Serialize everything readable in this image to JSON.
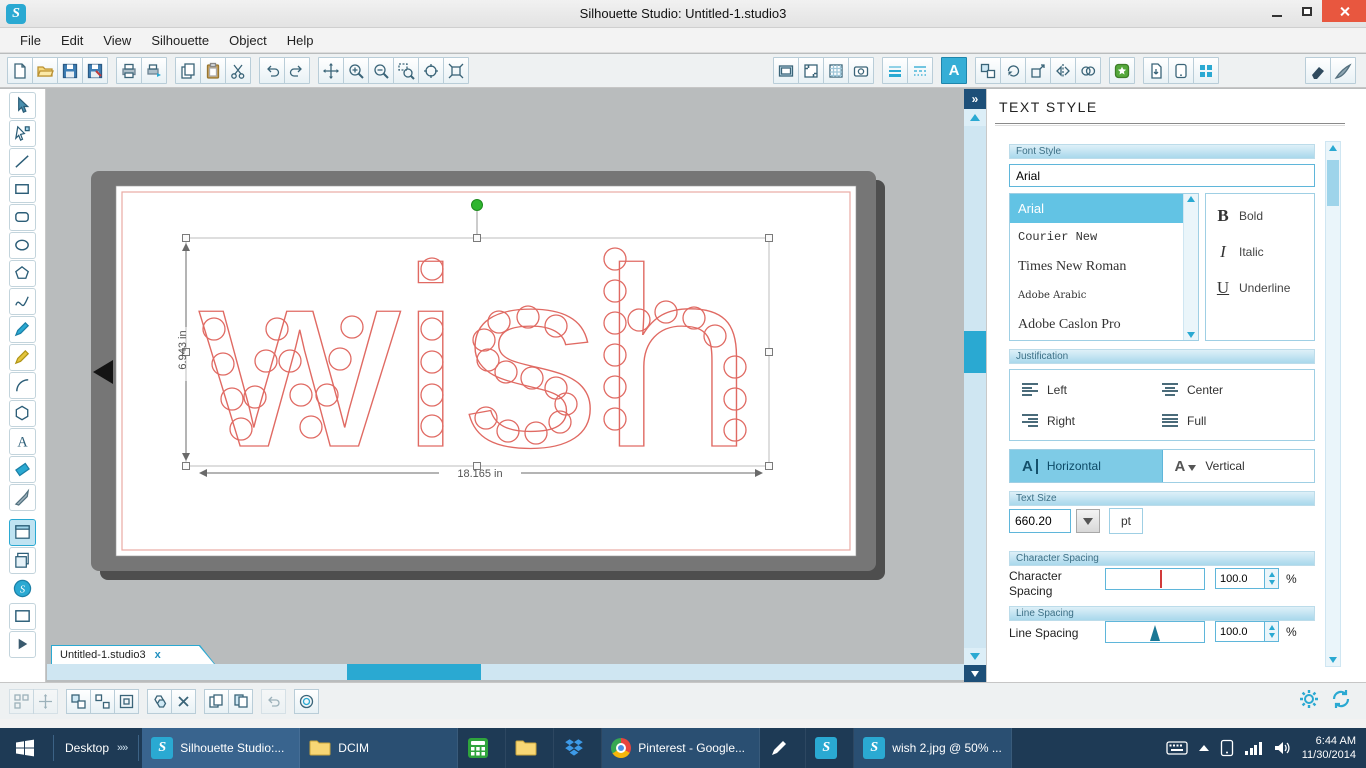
{
  "window": {
    "title": "Silhouette Studio: Untitled-1.studio3"
  },
  "menu": {
    "items": [
      "File",
      "Edit",
      "View",
      "Silhouette",
      "Object",
      "Help"
    ]
  },
  "canvas": {
    "collapse_glyph": "»",
    "tab_label": "Untitled-1.studio3",
    "tab_close": "x"
  },
  "design": {
    "text": "wish",
    "width_label": "18.165 in",
    "height_label": "6.943 in"
  },
  "panel": {
    "title": "TEXT STYLE",
    "font_style_header": "Font Style",
    "font_input": "Arial",
    "fonts": [
      {
        "name": "Arial"
      },
      {
        "name": "Courier New"
      },
      {
        "name": "Times New Roman"
      },
      {
        "name": "Adobe Arabic"
      },
      {
        "name": "Adobe Caslon Pro"
      }
    ],
    "styles": {
      "bold_glyph": "B",
      "bold_label": "Bold",
      "italic_glyph": "I",
      "italic_label": "Italic",
      "underline_glyph": "U",
      "underline_label": "Underline"
    },
    "justification_header": "Justification",
    "justify": {
      "left": "Left",
      "center": "Center",
      "right": "Right",
      "full": "Full"
    },
    "orientation": {
      "horizontal": "Horizontal",
      "vertical": "Vertical",
      "h_icon": "A",
      "v_icon": "A"
    },
    "text_size_header": "Text Size",
    "text_size_value": "660.20",
    "text_size_unit": "pt",
    "char_spacing_header": "Character Spacing",
    "char_spacing_label": "Character Spacing",
    "char_spacing_value": "100.0",
    "char_spacing_unit": "%",
    "line_spacing_header": "Line Spacing",
    "line_spacing_label": "Line Spacing",
    "line_spacing_value": "100.0",
    "line_spacing_unit": "%"
  },
  "taskbar": {
    "desktop_label": "Desktop",
    "tasks": [
      {
        "name": "silhouette-studio",
        "label": "Silhouette Studio:..."
      },
      {
        "name": "dcim-folder",
        "label": "DCIM"
      },
      {
        "name": "calculator",
        "label": ""
      },
      {
        "name": "file-explorer",
        "label": ""
      },
      {
        "name": "dropbox",
        "label": ""
      },
      {
        "name": "chrome-pinterest",
        "label": "Pinterest - Google..."
      },
      {
        "name": "pen-input",
        "label": ""
      },
      {
        "name": "silhouette-app",
        "label": ""
      },
      {
        "name": "wish-image",
        "label": "wish 2.jpg @ 50% ..."
      }
    ],
    "time": "6:44 AM",
    "date": "11/30/2014"
  },
  "colors": {
    "accent": "#2aa9d2",
    "active_tool": "#35aed6",
    "taskbar": "#1e3a55",
    "design_stroke": "#e06a63",
    "rotate_handle": "#2fb52f"
  }
}
